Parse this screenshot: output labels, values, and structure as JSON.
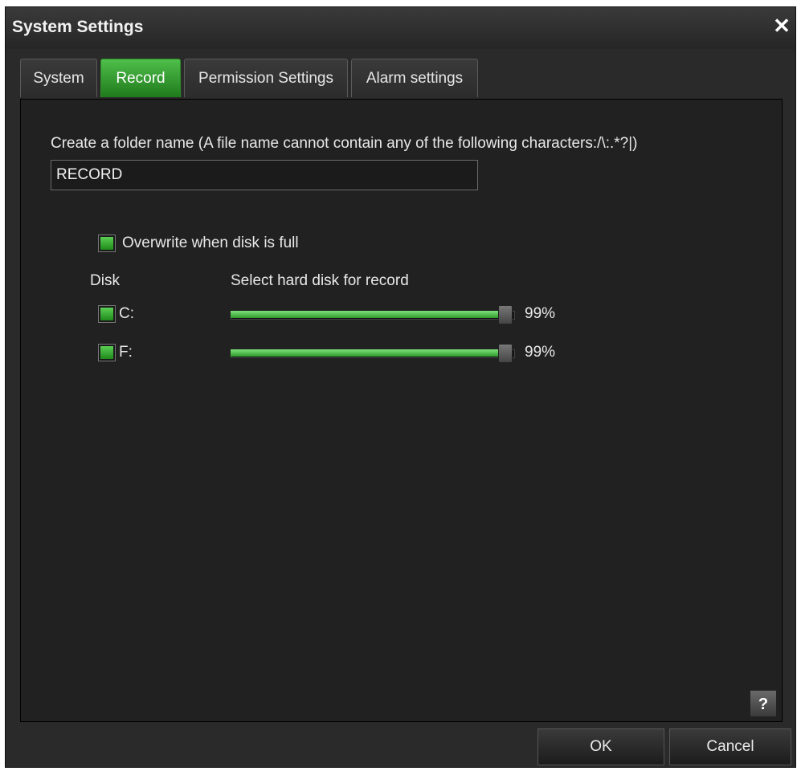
{
  "window": {
    "title": "System Settings",
    "close_glyph": "✕"
  },
  "tabs": [
    {
      "label": "System",
      "active": false
    },
    {
      "label": "Record",
      "active": true
    },
    {
      "label": "Permission Settings",
      "active": false
    },
    {
      "label": "Alarm settings",
      "active": false
    }
  ],
  "record": {
    "folder_label": "Create a folder name (A file name cannot contain any of the following characters:/\\:.*?|)",
    "folder_value": "RECORD",
    "overwrite": {
      "label": "Overwrite when disk is full",
      "checked": true
    },
    "disk_header": "Disk",
    "select_header": "Select hard disk for record",
    "disks": [
      {
        "label": "C:",
        "checked": true,
        "percent_text": "99%",
        "level": 0.99
      },
      {
        "label": "F:",
        "checked": true,
        "percent_text": "99%",
        "level": 0.99
      }
    ]
  },
  "help": {
    "glyph": "?"
  },
  "footer": {
    "ok_label": "OK",
    "cancel_label": "Cancel"
  },
  "colors": {
    "accent": "#2e9a2a",
    "background": "#212121",
    "panel": "#2a2a2a"
  },
  "icons": {
    "close": "close-icon",
    "help": "help-icon"
  }
}
